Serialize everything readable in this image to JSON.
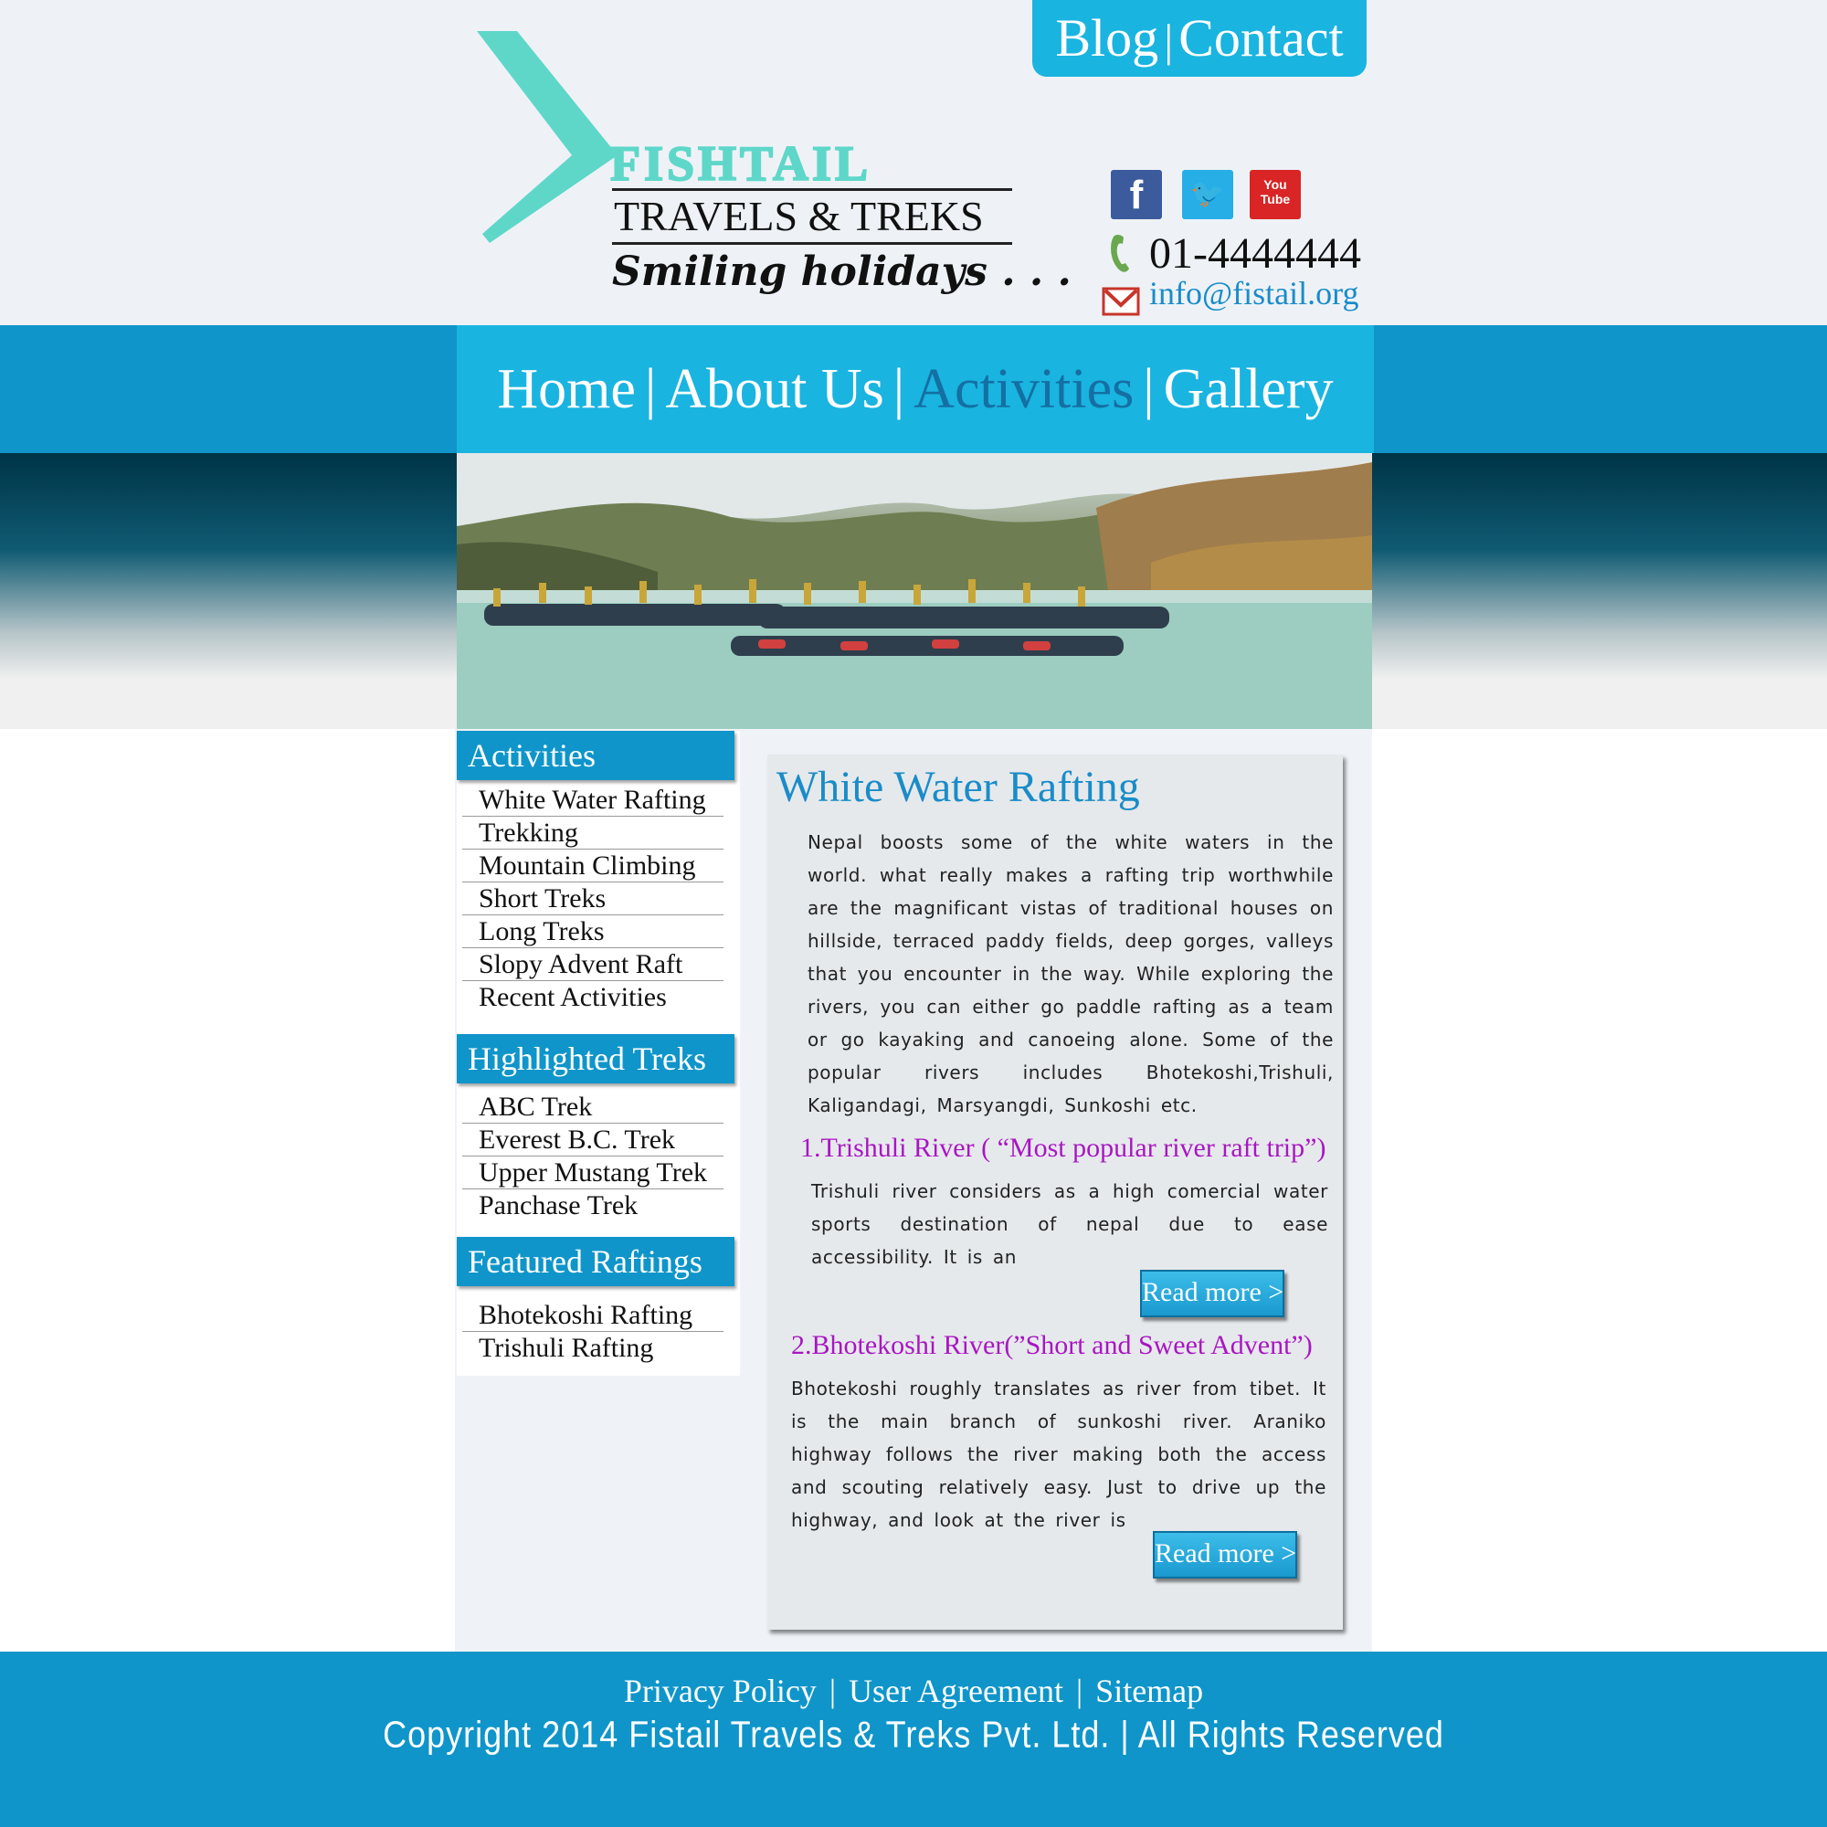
{
  "top_links": {
    "blog": "Blog",
    "separator": "|",
    "contact": "Contact"
  },
  "logo": {
    "brand": "FISHTAIL",
    "subtitle": "TRAVELS & TREKS",
    "tagline": "Smiling holidays . . ."
  },
  "social": [
    {
      "name": "facebook-icon",
      "glyph": "f"
    },
    {
      "name": "twitter-icon",
      "glyph": "🐦"
    },
    {
      "name": "youtube-icon",
      "glyph": "You Tube"
    }
  ],
  "contact": {
    "phone": "01-4444444",
    "email": "info@fistail.org"
  },
  "nav": {
    "items": [
      "Home",
      "About Us",
      "Activities",
      "Gallery"
    ],
    "separator": "|",
    "active": "Activities"
  },
  "sidebar": {
    "activities": {
      "heading": "Activities",
      "items": [
        "White Water Rafting",
        "Trekking",
        "Mountain Climbing",
        "Short Treks",
        "Long Treks",
        "Slopy Advent Raft",
        "Recent Activities"
      ]
    },
    "highlighted": {
      "heading": "Highlighted Treks",
      "items": [
        "ABC Trek",
        "Everest B.C. Trek",
        "Upper Mustang Trek",
        "Panchase Trek"
      ]
    },
    "featured": {
      "heading": "Featured Raftings",
      "items": [
        "Bhotekoshi Rafting",
        "Trishuli Rafting"
      ]
    }
  },
  "main": {
    "title": "White Water Rafting",
    "intro": "Nepal boosts some of the white waters in the world. what really makes a rafting trip worthwhile are the magnificant vistas of traditional houses on hillside, terraced paddy fields, deep gorges, valleys that you encounter in the way. While exploring the rivers, you can either go paddle rafting as a team or go kayaking and canoeing alone. Some of the popular rivers includes Bhotekoshi,Trishuli, Kaligandagi, Marsyangdi, Sunkoshi etc.",
    "sections": [
      {
        "title": "1.Trishuli River ( “Most popular river raft trip”)",
        "text": "Trishuli river considers as a high comercial water sports destination of nepal due to ease accessibility. It is an",
        "button": "Read more >"
      },
      {
        "title": "2.Bhotekoshi River(”Short and Sweet Advent”)",
        "text": "Bhotekoshi roughly translates as river from tibet. It is the main branch of sunkoshi river. Araniko highway follows the river making both the access and scouting relatively easy. Just to drive up the highway, and look at the river is",
        "button": "Read more >"
      }
    ]
  },
  "footer": {
    "links": [
      "Privacy Policy",
      "User Agreement",
      "Sitemap"
    ],
    "separator": "|",
    "copyright": "Copyright 2014 Fistail Travels & Treks Pvt. Ltd.  |  All Rights Reserved"
  },
  "colors": {
    "accent": "#1ab4e0",
    "nav_band": "#0f95c9",
    "active_nav": "#146fa3",
    "title_blue": "#1a8cc8",
    "subtitle_purple": "#a816c2",
    "logo_teal": "#5ed7c9"
  }
}
